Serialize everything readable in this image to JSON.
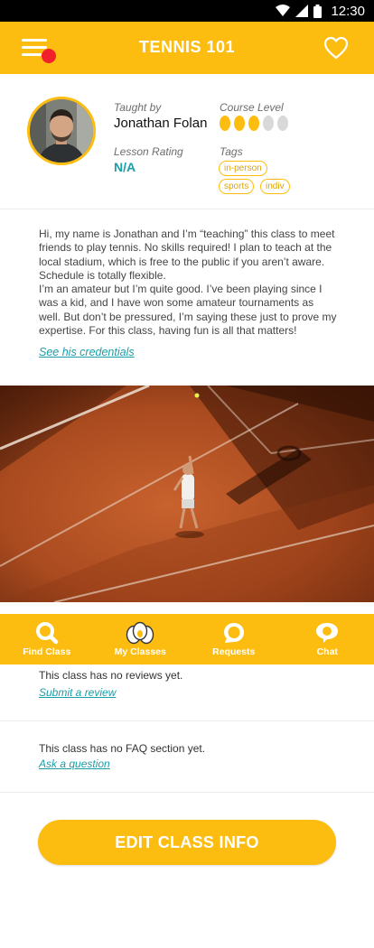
{
  "status_bar": {
    "time": "12:30"
  },
  "header": {
    "title": "TENNIS 101"
  },
  "instructor": {
    "taught_by_label": "Taught by",
    "name": "Jonathan Folan",
    "rating_label": "Lesson Rating",
    "rating_value": "N/A",
    "level_label": "Course Level",
    "level": 3,
    "level_max": 5,
    "tags_label": "Tags",
    "tags": [
      "in-person",
      "sports",
      "indiv"
    ]
  },
  "description": {
    "paragraph_1": "Hi, my name is Jonathan and I’m “teaching” this class to meet friends to play tennis. No skills required! I plan to teach at the local stadium, which is free to the public if you aren’t aware. Schedule is totally flexible.",
    "paragraph_2": "I’m an amateur but I’m quite good. I’ve been playing since I was a kid, and I have won some amateur tournaments as well. But don’t be pressured, I’m saying these just to prove my expertise. For this class, having fun is all that matters!",
    "credentials_link": "See his credentials"
  },
  "bottom_nav": {
    "items": [
      {
        "label": "Find Class",
        "icon": "search-icon"
      },
      {
        "label": "My Classes",
        "icon": "eggs-icon"
      },
      {
        "label": "Requests",
        "icon": "request-bubble-icon"
      },
      {
        "label": "Chat",
        "icon": "chat-bubble-icon"
      }
    ],
    "active_index": 1
  },
  "reviews": {
    "empty_text": "This class has no reviews yet.",
    "action_link": "Submit a review"
  },
  "faq": {
    "empty_text": "This class has no FAQ section yet.",
    "action_link": "Ask a question"
  },
  "edit_button": {
    "label": "EDIT CLASS INFO"
  },
  "colors": {
    "primary": "#fdbd10",
    "accent": "#1a9ea8",
    "badge": "#f2202a",
    "inactive": "#d9d9d9"
  }
}
